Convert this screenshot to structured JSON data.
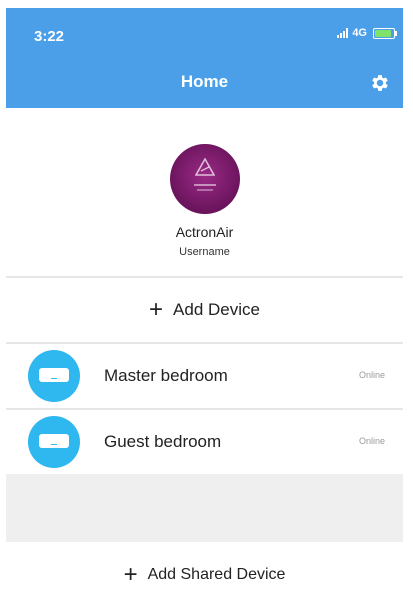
{
  "status_bar": {
    "time": "3:22",
    "network": "4G"
  },
  "header": {
    "title": "Home",
    "settings_icon": "gear-icon"
  },
  "profile": {
    "brand": "ActronAir",
    "username": "Username"
  },
  "add_device": {
    "icon": "plus-icon",
    "label": "Add Device"
  },
  "devices": [
    {
      "name": "Master bedroom",
      "status": "Online",
      "icon": "air-conditioner-icon"
    },
    {
      "name": "Guest bedroom",
      "status": "Online",
      "icon": "air-conditioner-icon"
    }
  ],
  "add_shared": {
    "icon": "plus-icon",
    "label": "Add Shared Device"
  },
  "colors": {
    "header": "#4a9fe8",
    "device_icon": "#2fb7ef",
    "avatar": "#6a145c",
    "battery": "#7fe36b"
  }
}
